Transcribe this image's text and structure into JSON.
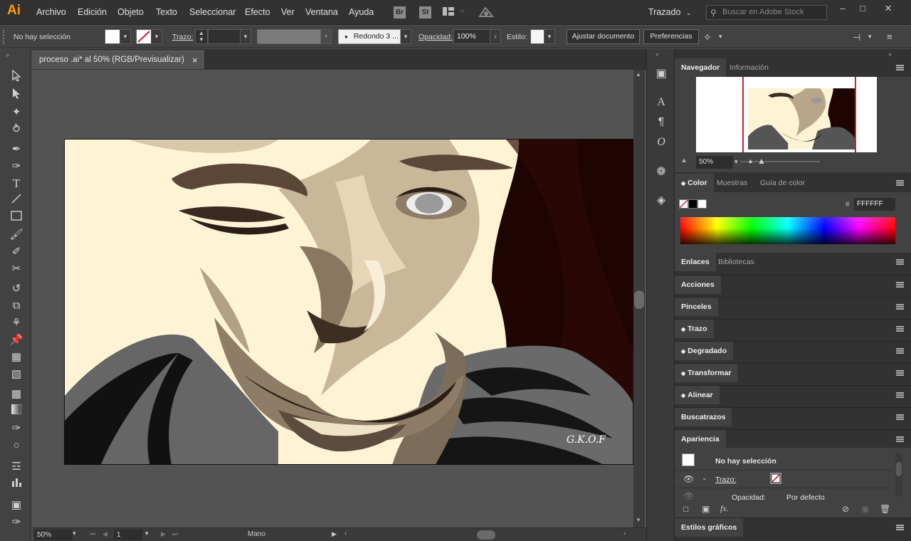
{
  "app": {
    "logo": "Ai"
  },
  "menu": [
    "Archivo",
    "Edición",
    "Objeto",
    "Texto",
    "Seleccionar",
    "Efecto",
    "Ver",
    "Ventana",
    "Ayuda"
  ],
  "menubar_right": {
    "bridge": "Br",
    "stock_app": "St",
    "workspace": "Trazado",
    "search_placeholder": "Buscar en Adobe Stock"
  },
  "control": {
    "selection": "No hay selección",
    "stroke_label": "Trazo:",
    "brush": "Redondo 3 ...",
    "opacity_label": "Opacidad:",
    "opacity_value": "100%",
    "style_label": "Estilo:",
    "doc_setup": "Ajustar documento",
    "preferences": "Preferencias"
  },
  "doc_tab": {
    "title": "proceso .ai* al 50% (RGB/Previsualizar)",
    "close": "×"
  },
  "status": {
    "zoom": "50%",
    "artboard_num": "1",
    "tool": "Mano"
  },
  "artwork": {
    "signature": "G.K.O.F"
  },
  "navigator": {
    "tabs": [
      "Navegador",
      "Información"
    ],
    "zoom": "50%"
  },
  "color": {
    "tabs": [
      "Color",
      "Muestras",
      "Guía de color"
    ],
    "hex_label": "#",
    "hex": "FFFFFF"
  },
  "links": {
    "tabs": [
      "Enlaces",
      "Bibliotecas"
    ]
  },
  "collapsed_panels": [
    "Acciones",
    "Pinceles",
    "Trazo",
    "Degradado",
    "Transformar",
    "Alinear",
    "Buscatrazos"
  ],
  "appearance": {
    "tab": "Apariencia",
    "selection": "No hay selección",
    "stroke": "Trazo:",
    "opacity": "Opacidad:",
    "opacity_value": "Por defecto"
  },
  "graphic_styles": {
    "tab": "Estilos gráficos"
  },
  "colors": {
    "accent_orange": "#ff9a00",
    "stroke_red": "#d0202a",
    "face_light": "#fff3d5",
    "bg_dark": "#1e0402"
  }
}
